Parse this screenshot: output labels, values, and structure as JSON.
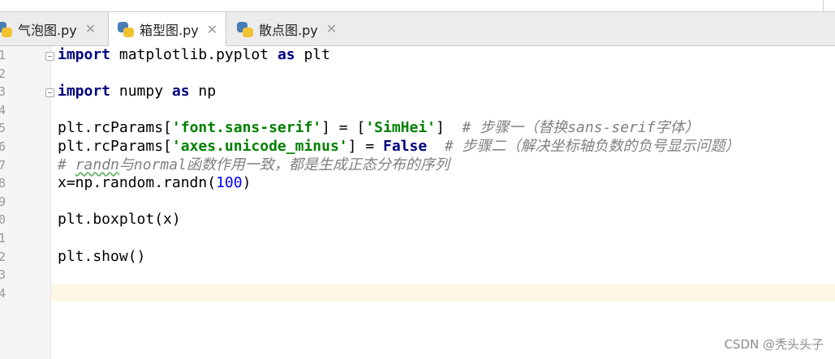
{
  "tabs": [
    {
      "label": "气泡图.py",
      "active": false
    },
    {
      "label": "箱型图.py",
      "active": true
    },
    {
      "label": "散点图.py",
      "active": false
    }
  ],
  "icons": {
    "file": "python-file-icon",
    "close": "close-icon"
  },
  "line_numbers": [
    "1",
    "2",
    "3",
    "4",
    "5",
    "6",
    "7",
    "8",
    "9",
    "0",
    "1",
    "2",
    "3",
    "4"
  ],
  "code": {
    "l1_kw1": "import",
    "l1_mid": " matplotlib.pyplot ",
    "l1_kw2": "as",
    "l1_tail": " plt",
    "l3_kw1": "import",
    "l3_mid": " numpy ",
    "l3_kw2": "as",
    "l3_tail": " np",
    "l5_a": "plt.rcParams[",
    "l5_s1": "'font.sans-serif'",
    "l5_b": "] = [",
    "l5_s2": "'SimHei'",
    "l5_c": "]  ",
    "l5_cmt": "# 步骤一（替换sans-serif字体）",
    "l6_a": "plt.rcParams[",
    "l6_s1": "'axes.unicode_minus'",
    "l6_b": "] = ",
    "l6_kw": "False",
    "l6_c": "  ",
    "l6_cmt": "# 步骤二（解决坐标轴负数的负号显示问题）",
    "l7_cmt1": "# ",
    "l7_typo": "randn",
    "l7_cmt2": "与normal函数作用一致，都是生成正态分布的序列",
    "l8_a": "x=np.random.randn(",
    "l8_num": "100",
    "l8_b": ")",
    "l10": "plt.boxplot(x)",
    "l12": "plt.show()"
  },
  "watermark": "CSDN @秃头头子",
  "colors": {
    "keyword": "#000080",
    "string": "#008000",
    "number": "#0000ff",
    "comment": "#808080",
    "current_line": "#fdf8e6"
  }
}
